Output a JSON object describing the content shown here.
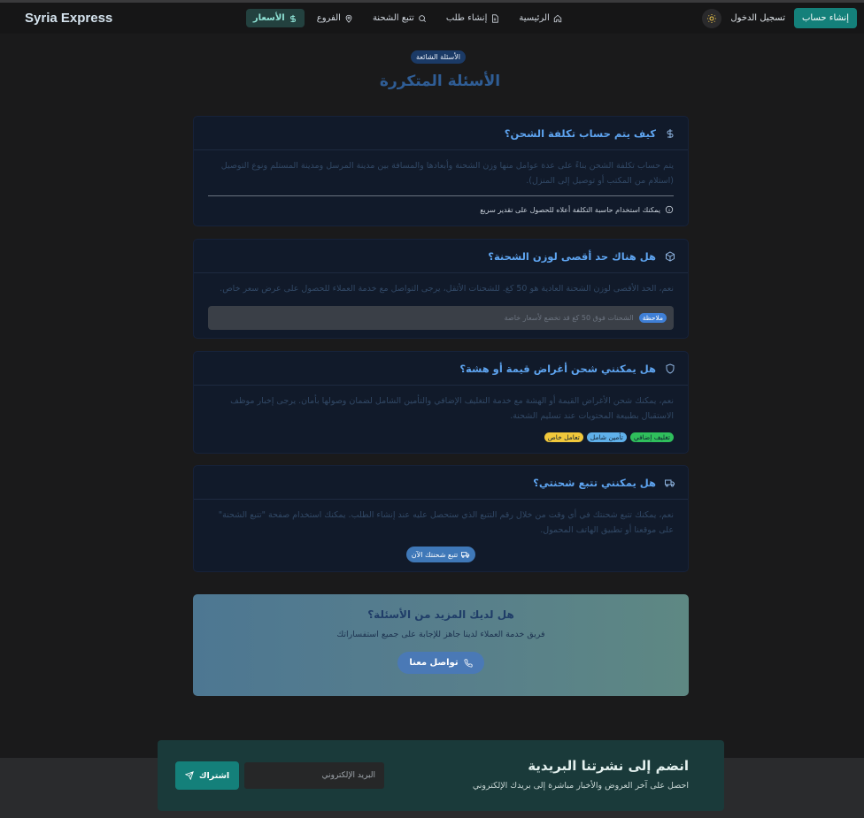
{
  "header": {
    "brand": "Syria Express",
    "nav": [
      {
        "label": "الرئيسية",
        "icon": "home-icon"
      },
      {
        "label": "إنشاء طلب",
        "icon": "document-icon"
      },
      {
        "label": "تتبع الشحنة",
        "icon": "search-icon"
      },
      {
        "label": "الفروع",
        "icon": "map-pin-icon"
      },
      {
        "label": "الأسعار",
        "icon": "dollar-icon",
        "active": true
      }
    ],
    "login_label": "تسجيل الدخول",
    "signup_label": "إنشاء حساب"
  },
  "hero": {
    "badge": "الأسئلة الشائعة",
    "title": "الأسئلة المتكررة"
  },
  "faq": [
    {
      "question": "كيف يتم حساب تكلفة الشحن؟",
      "icon": "dollar-icon",
      "answer": "يتم حساب تكلفة الشحن بناءً على عدة عوامل منها وزن الشحنة وأبعادها والمسافة بين مدينة المرسل ومدينة المستلم ونوع التوصيل (استلام من المكتب أو توصيل إلى المنزل).",
      "tip": "يمكنك استخدام حاسبة التكلفة أعلاه للحصول على تقدير سريع"
    },
    {
      "question": "هل هناك حد أقصى لوزن الشحنة؟",
      "icon": "box-icon",
      "answer": "نعم، الحد الأقصى لوزن الشحنة العادية هو 50 كغ. للشحنات الأثقل، يرجى التواصل مع خدمة العملاء للحصول على عرض سعر خاص.",
      "note_tag": "ملاحظة",
      "note_text": "الشحنات فوق 50 كغ قد تخضع لأسعار خاصة"
    },
    {
      "question": "هل يمكنني شحن أغراض قيمة أو هشة؟",
      "icon": "shield-icon",
      "answer": "نعم، يمكنك شحن الأغراض القيمة أو الهشة مع خدمة التغليف الإضافي والتأمين الشامل لضمان وصولها بأمان. يرجى إخبار موظف الاستقبال بطبيعة المحتويات عند تسليم الشحنة.",
      "tags": [
        {
          "label": "تغليف إضافي",
          "color": "#2fbf5c"
        },
        {
          "label": "تأمين شامل",
          "color": "#5fb0ea"
        },
        {
          "label": "تعامل خاص",
          "color": "#f1c83b"
        }
      ]
    },
    {
      "question": "هل يمكنني تتبع شحنتي؟",
      "icon": "truck-icon",
      "answer": "نعم، يمكنك تتبع شحنتك في أي وقت من خلال رقم التتبع الذي ستحصل عليه عند إنشاء الطلب. يمكنك استخدام صفحة \"تتبع الشحنة\" على موقعنا أو تطبيق الهاتف المحمول.",
      "button": "تتبع شحنتك الآن"
    }
  ],
  "cta": {
    "title": "هل لديك المزيد من الأسئلة؟",
    "subtitle": "فريق خدمة العملاء لدينا جاهز للإجابة على جميع استفساراتك",
    "button": "تواصل معنا"
  },
  "newsletter": {
    "title": "انضم إلى نشرتنا البريدية",
    "subtitle": "احصل على آخر العروض والأخبار مباشرة إلى بريدك الإلكتروني",
    "placeholder": "البريد الإلكتروني",
    "button": "اشتراك"
  },
  "colors": {
    "accent": "#14807a",
    "link": "#5ea4f0",
    "card_bg": "#111a2a"
  }
}
